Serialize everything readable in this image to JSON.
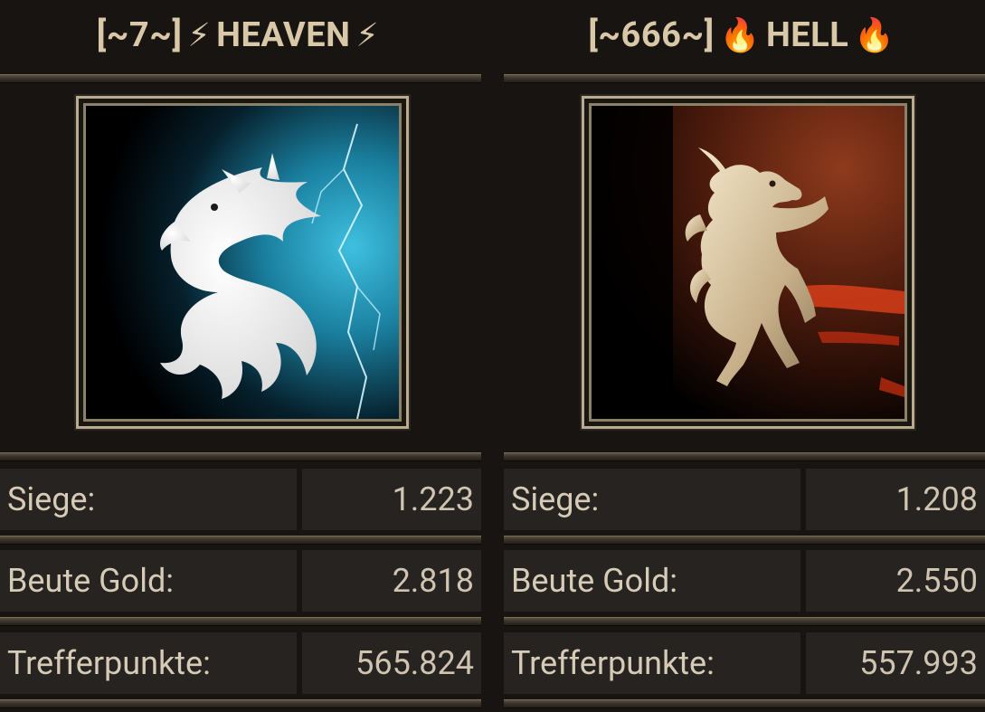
{
  "teams": [
    {
      "title_prefix": "[~7~]",
      "title_emoji_left": "⚡",
      "title_name": "HEAVEN",
      "title_emoji_right": "⚡",
      "emblem": "white-dragon-icon",
      "emblem_accent": "#2aa6c9",
      "stats": [
        {
          "label": "Siege:",
          "value": "1.223"
        },
        {
          "label": "Beute Gold:",
          "value": "2.818"
        },
        {
          "label": "Trefferpunkte:",
          "value": "565.824"
        }
      ]
    },
    {
      "title_prefix": "[~666~]",
      "title_emoji_left": "🔥",
      "title_name": "HELL",
      "title_emoji_right": "🔥",
      "emblem": "golden-rampant-beast-icon",
      "emblem_accent": "#8a3418",
      "stats": [
        {
          "label": "Siege:",
          "value": "1.208"
        },
        {
          "label": "Beute Gold:",
          "value": "2.550"
        },
        {
          "label": "Trefferpunkte:",
          "value": "557.993"
        }
      ]
    }
  ]
}
